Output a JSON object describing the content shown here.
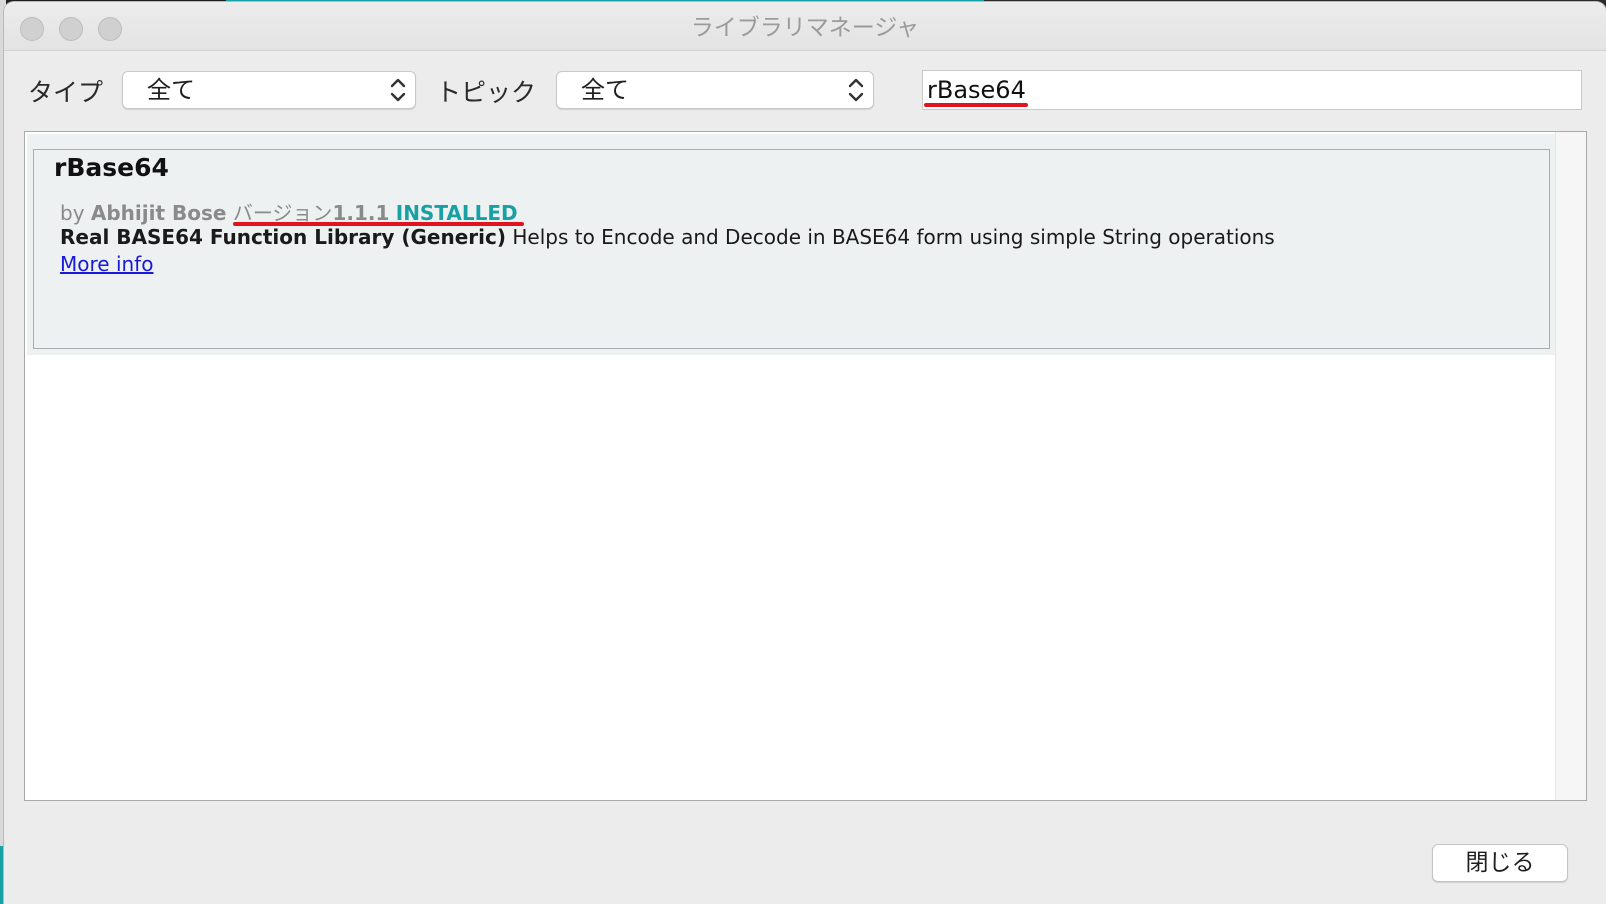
{
  "window": {
    "title": "ライブラリマネージャ"
  },
  "filters": {
    "type_label": "タイプ",
    "type_value": "全て",
    "topic_label": "トピック",
    "topic_value": "全て",
    "search_value": "rBase64"
  },
  "library": {
    "name": "rBase64",
    "by_prefix": "by",
    "author": "Abhijit Bose",
    "version_label": "バージョン",
    "version": "1.1.1",
    "status": "INSTALLED",
    "title_bold": "Real BASE64 Function Library (Generic)",
    "description": "Helps to Encode and Decode in BASE64 form using simple String operations",
    "more_info": "More info"
  },
  "footer": {
    "close_label": "閉じる"
  },
  "colors": {
    "installed": "#17a1a5",
    "link": "#1a1ad6",
    "annotation": "#e0141e"
  }
}
